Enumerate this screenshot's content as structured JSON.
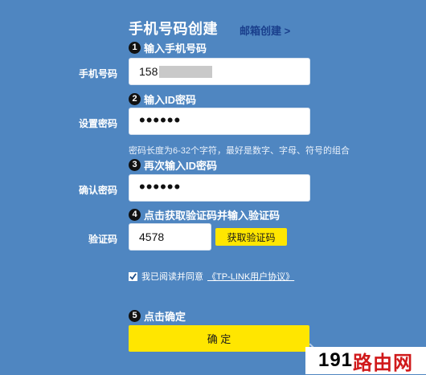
{
  "header": {
    "title": "手机号码创建",
    "email_link": "邮箱创建 >"
  },
  "steps": [
    {
      "num": "1",
      "label": "输入手机号码"
    },
    {
      "num": "2",
      "label": "输入ID密码"
    },
    {
      "num": "3",
      "label": "再次输入ID密码"
    },
    {
      "num": "4",
      "label": "点击获取验证码并输入验证码"
    },
    {
      "num": "5",
      "label": "点击确定"
    }
  ],
  "fields": {
    "phone": {
      "label": "手机号码",
      "value_prefix": "158"
    },
    "password": {
      "label": "设置密码",
      "value": "••••••"
    },
    "password_hint": "密码长度为6-32个字符，最好是数字、字母、符号的组合",
    "confirm_password": {
      "label": "确认密码",
      "value": "••••••"
    },
    "code": {
      "label": "验证码",
      "value": "4578",
      "get_code_label": "获取验证码"
    }
  },
  "agreement": {
    "checked": true,
    "text": "我已阅读并同意",
    "link": "《TP-LINK用户协议》"
  },
  "confirm_button": "确 定",
  "watermark": {
    "number": "191",
    "text": "路由网"
  }
}
